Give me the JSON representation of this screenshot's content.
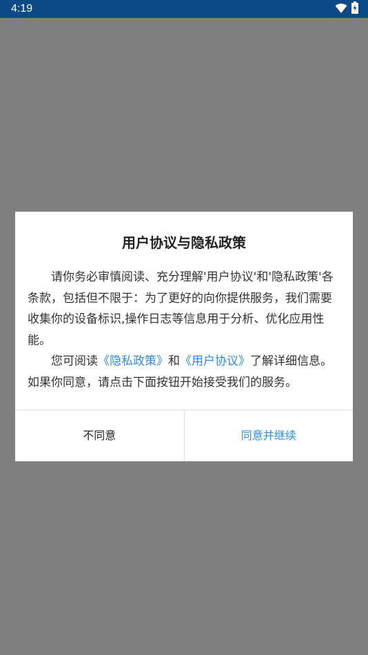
{
  "status_bar": {
    "time": "4:19",
    "icons": [
      "wifi-icon",
      "battery-charging-icon"
    ],
    "background": "#0b4a86"
  },
  "dialog": {
    "title": "用户协议与隐私政策",
    "paragraph1": "请你务必审慎阅读、充分理解'用户协议'和'隐私政策'各条款，包括但不限于：为了更好的向你提供服务，我们需要收集你的设备标识,操作日志等信息用于分析、优化应用性能。",
    "paragraph2": {
      "prefix": "您可阅读",
      "privacy_link": "《隐私政策》",
      "middle": "和",
      "user_link": "《用户协议》",
      "suffix": "了解详细信息。如果你同意，请点击下面按钮开始接受我们的服务。"
    },
    "buttons": {
      "disagree": "不同意",
      "agree": "同意并继续"
    },
    "link_color": "#2d8cde"
  }
}
